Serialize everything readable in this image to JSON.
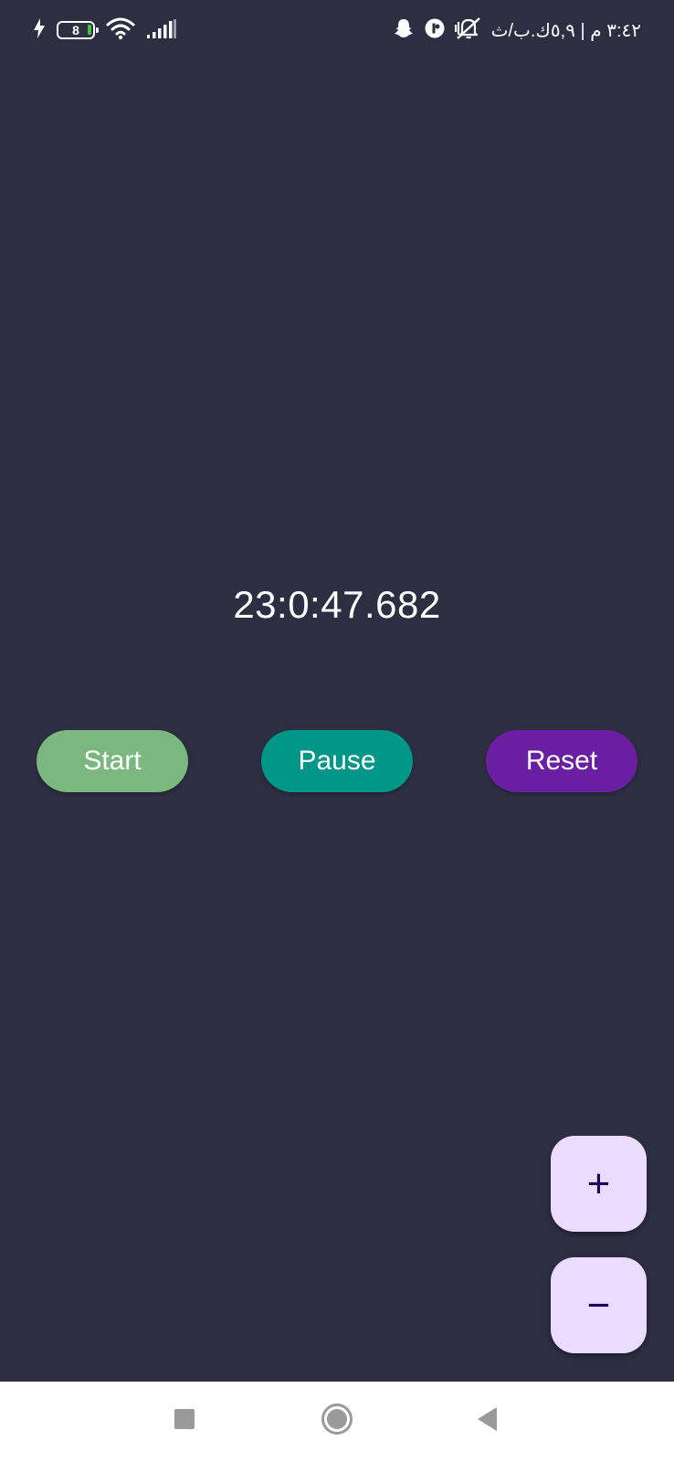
{
  "status_bar": {
    "battery_level": "8",
    "right_text": "٣:٤٢ م | ٥,٩ك.ب/ث",
    "icons": [
      "charging-bolt-icon",
      "battery-icon",
      "wifi-icon",
      "signal-bars-icon",
      "snapchat-ghost-icon",
      "app-notification-icon",
      "silent-vibrate-icon"
    ]
  },
  "timer": {
    "display": "23:0:47.682"
  },
  "controls": {
    "start_label": "Start",
    "pause_label": "Pause",
    "reset_label": "Reset"
  },
  "fab": {
    "plus_label": "+",
    "minus_label": "−"
  },
  "navigation": {
    "icons": [
      "recents-square-icon",
      "home-circle-icon",
      "back-triangle-icon"
    ]
  },
  "colors": {
    "background": "#2e2e42",
    "start_button": "#7ab87f",
    "pause_button": "#009688",
    "reset_button": "#6a1ea1",
    "fab_background": "#ebdcff",
    "fab_icon": "#21005d",
    "nav_bar": "#ffffff"
  }
}
